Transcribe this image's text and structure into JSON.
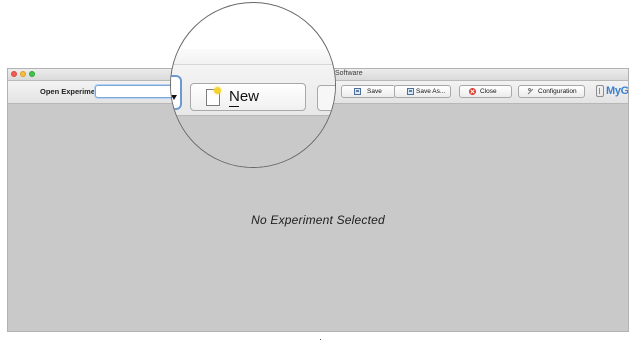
{
  "window": {
    "title": "R Software"
  },
  "toolbar": {
    "open_label": "Open Experiments:",
    "selected_experiment": "",
    "buttons": {
      "save": "Save",
      "save_as": "Save As...",
      "close": "Close",
      "configuration": "Configuration",
      "new": "New"
    }
  },
  "branding": {
    "logo_text": "MyGo"
  },
  "main": {
    "empty_message": "No Experiment Selected"
  },
  "icons": [
    "traffic-red-icon",
    "traffic-yellow-icon",
    "traffic-green-icon",
    "new-icon",
    "save-icon",
    "save-as-icon",
    "close-icon",
    "configuration-icon",
    "mygo-logo-icon"
  ],
  "colors": {
    "window_bg": "#c9c9c9",
    "toolbar_bg": "#e8e8e8",
    "logo_blue": "#3b7fd0",
    "close_red": "#d93a2f",
    "selection_blue": "#6f99d1"
  }
}
